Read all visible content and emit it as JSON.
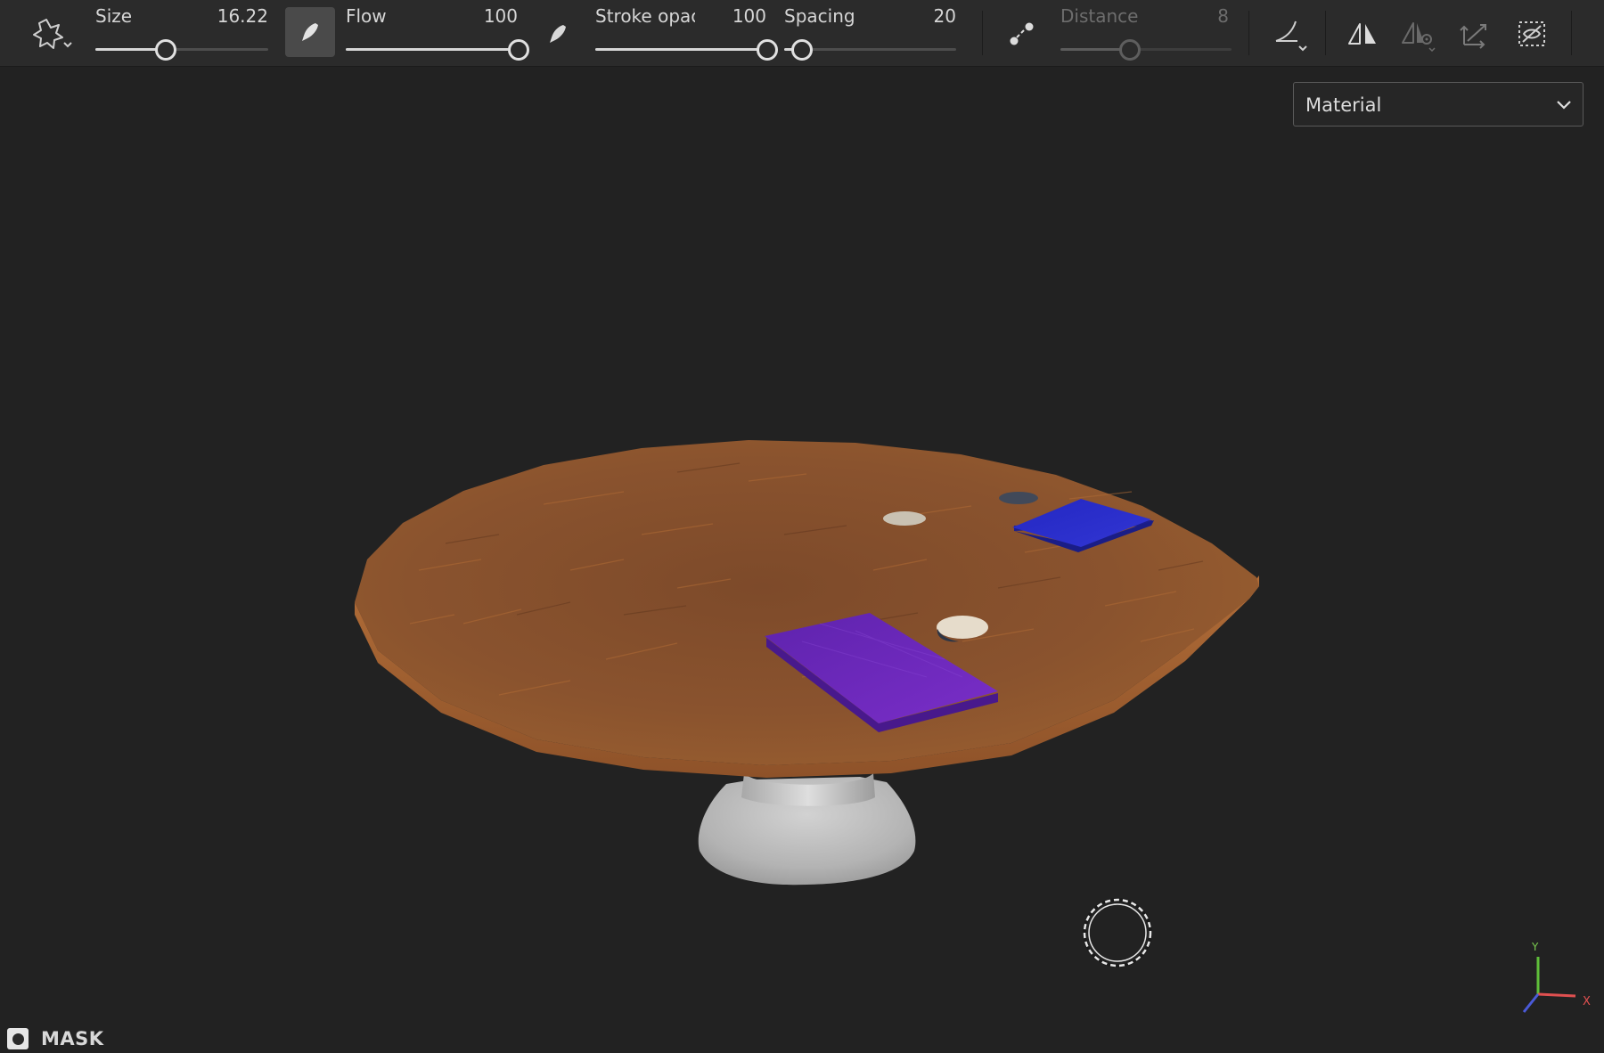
{
  "toolbar": {
    "brush_shape_icon": "stencil-star-icon",
    "size": {
      "label": "Size",
      "value": "16.22",
      "level": 0.4
    },
    "flow": {
      "label": "Flow",
      "value": "100",
      "level": 1.0
    },
    "stroke_opacity": {
      "label": "Stroke opacity",
      "value": "100",
      "level": 1.0
    },
    "spacing": {
      "label": "Spacing",
      "value": "20",
      "level": 0.1
    },
    "distance": {
      "label": "Distance",
      "value": "8",
      "level": 0.4
    },
    "icons": {
      "flow_pressure": "pen-pressure-icon",
      "opacity_pressure": "pen-pressure-icon",
      "lazy_mouse": "lazy-mouse-icon",
      "alignment": "alignment-curve-icon",
      "symmetry": "symmetry-icon",
      "symmetry_settings": "symmetry-settings-icon",
      "projection": "projection-icon",
      "hide_selection": "hide-selection-icon"
    }
  },
  "viewport": {
    "channel_dropdown": {
      "selected": "Material"
    },
    "mask_label": "MASK",
    "axis": {
      "y": "Y",
      "x": "X"
    }
  },
  "colors": {
    "toolbar_bg": "#2b2b2b",
    "viewport_bg": "#222222",
    "table_wood": "#8a5530",
    "book_blue": "#2a2ec8",
    "book_purple": "#6a27b8",
    "pedestal": "#b8b8b8"
  }
}
